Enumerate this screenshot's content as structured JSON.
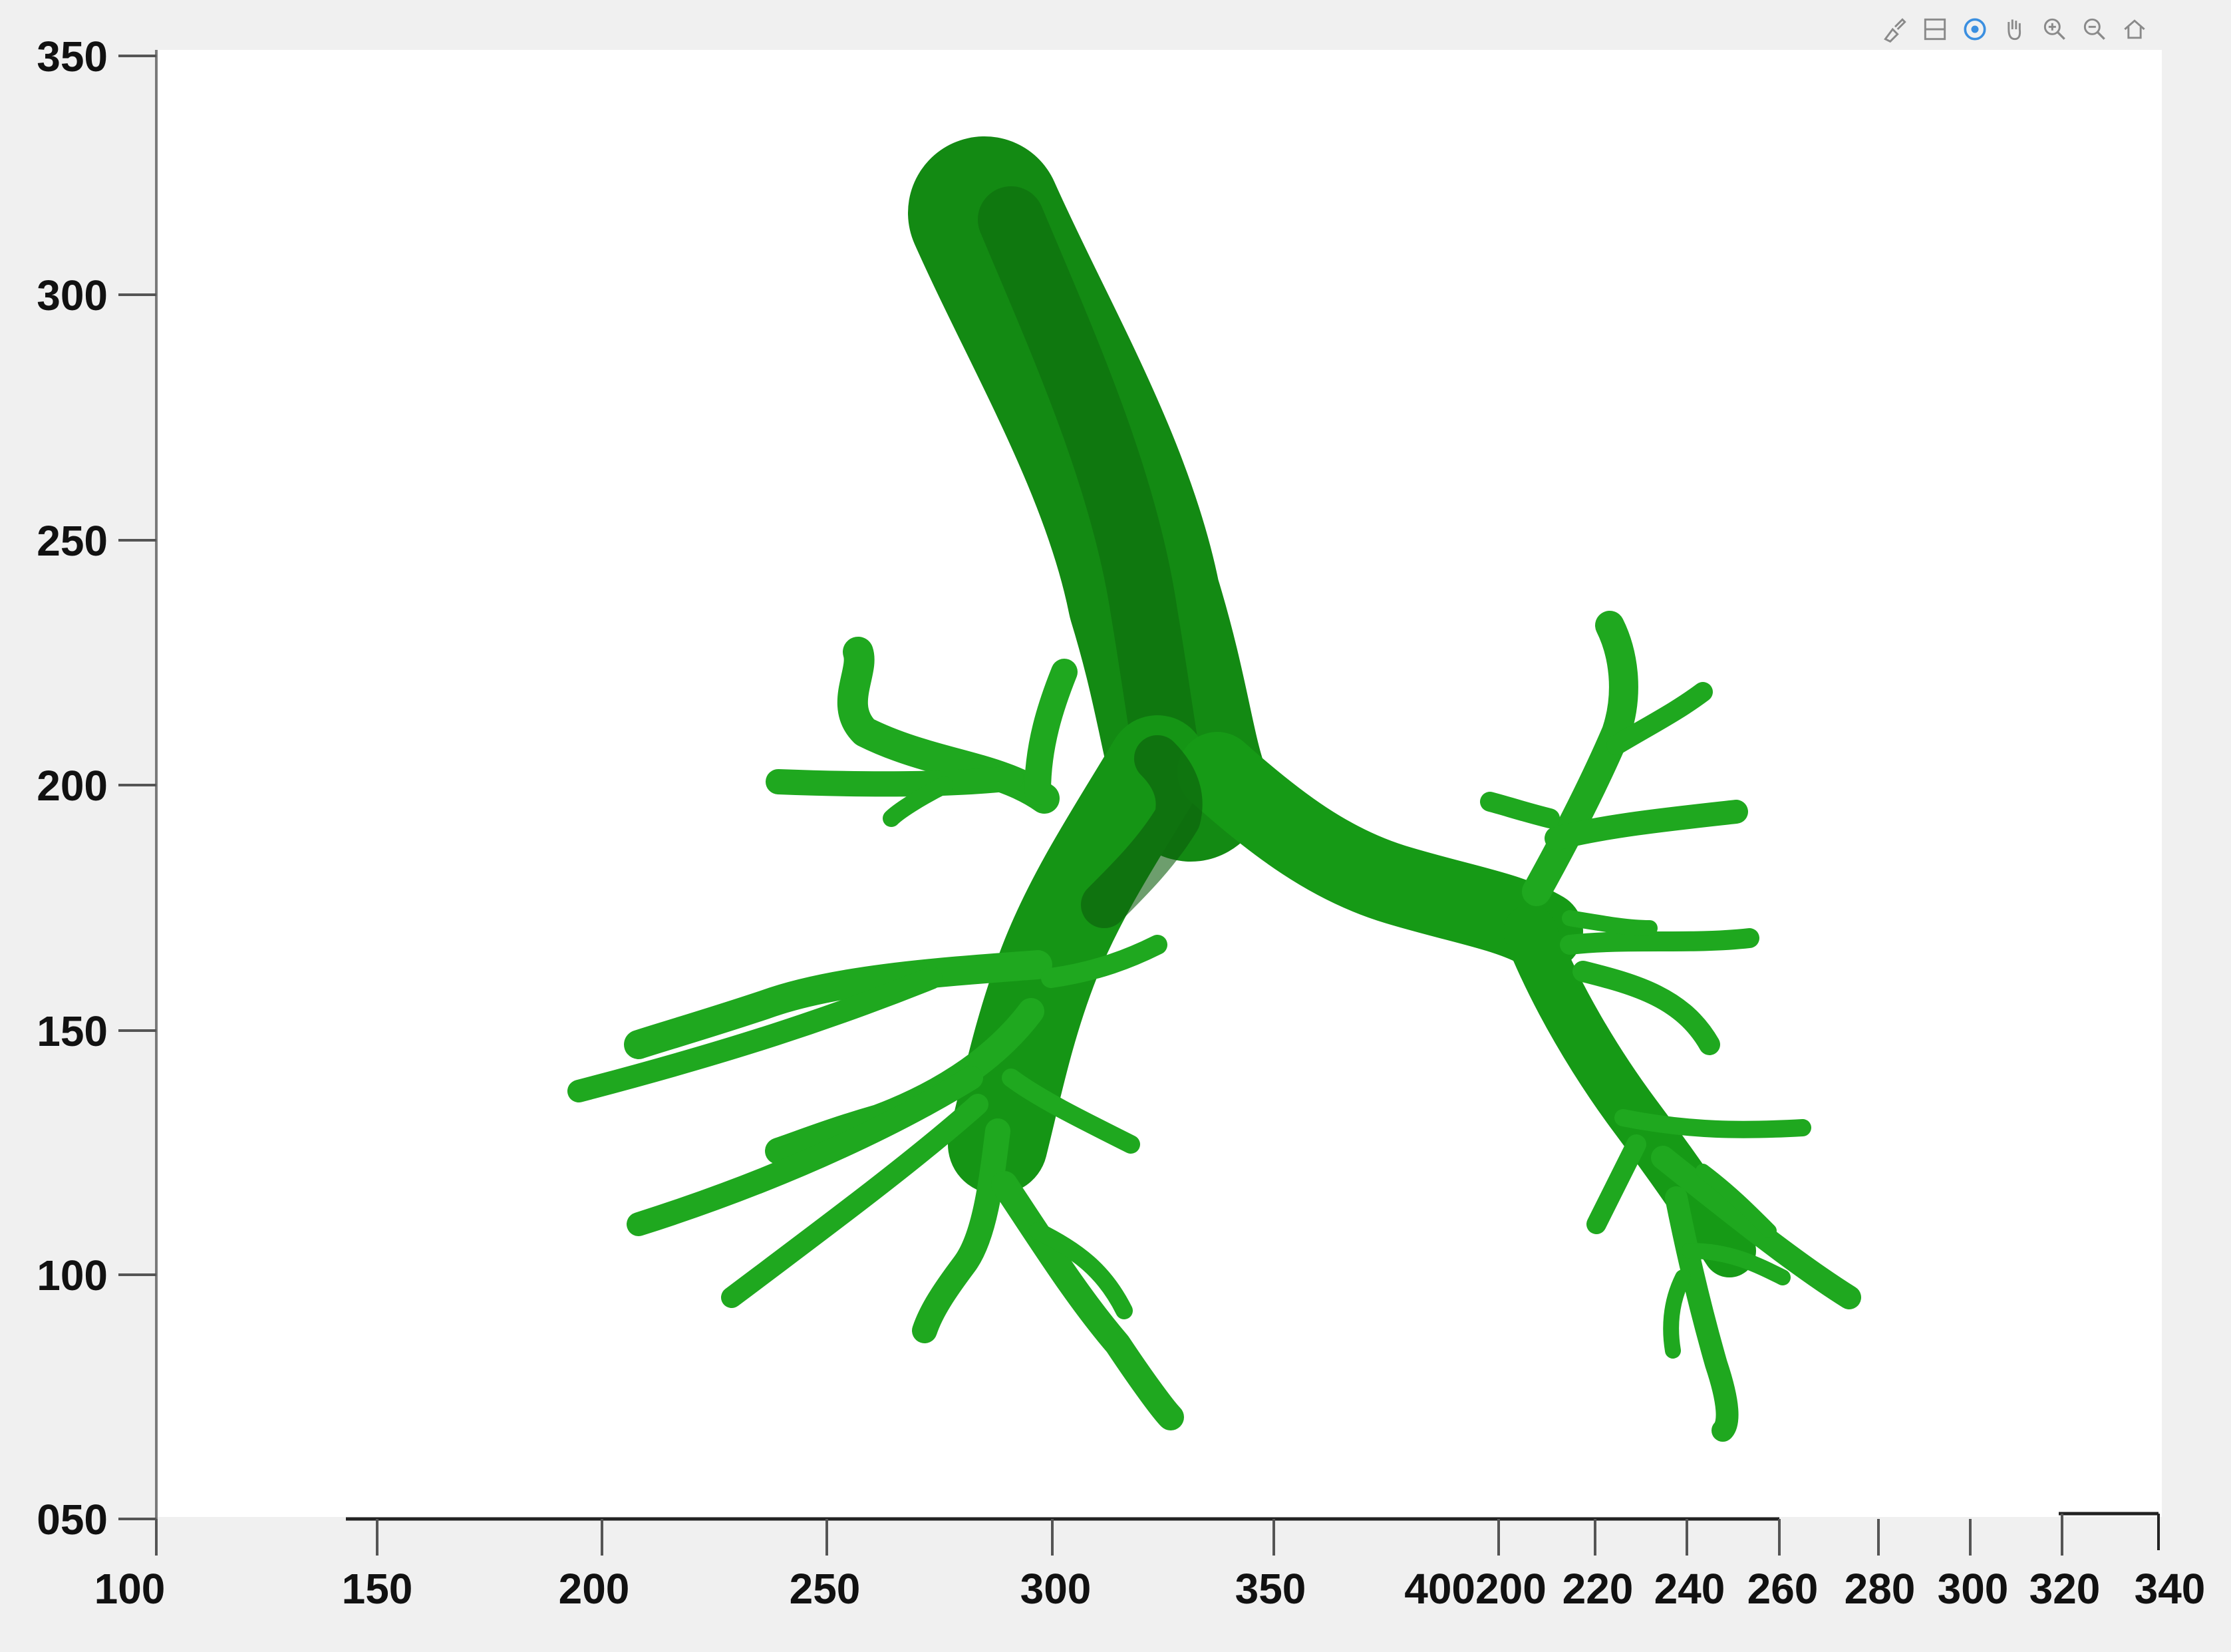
{
  "toolbar": {
    "items": [
      {
        "name": "brush-icon"
      },
      {
        "name": "data-cursor-icon"
      },
      {
        "name": "rotate-3d-icon"
      },
      {
        "name": "pan-icon"
      },
      {
        "name": "zoom-in-icon"
      },
      {
        "name": "zoom-out-icon"
      },
      {
        "name": "restore-view-icon"
      }
    ]
  },
  "axes": {
    "y_ticks": [
      "350",
      "300",
      "250",
      "200",
      "150",
      "100",
      "050"
    ],
    "x_ticks": [
      "100",
      "150",
      "200",
      "250",
      "300",
      "350",
      "400200",
      "220",
      "240",
      "260",
      "280",
      "300",
      "320",
      "340"
    ]
  },
  "colors": {
    "airway_light": "#1fa81f",
    "airway_mid": "#169016",
    "airway_dark": "#0b5e0b",
    "background": "#ffffff",
    "frame": "#f0f0f0"
  }
}
